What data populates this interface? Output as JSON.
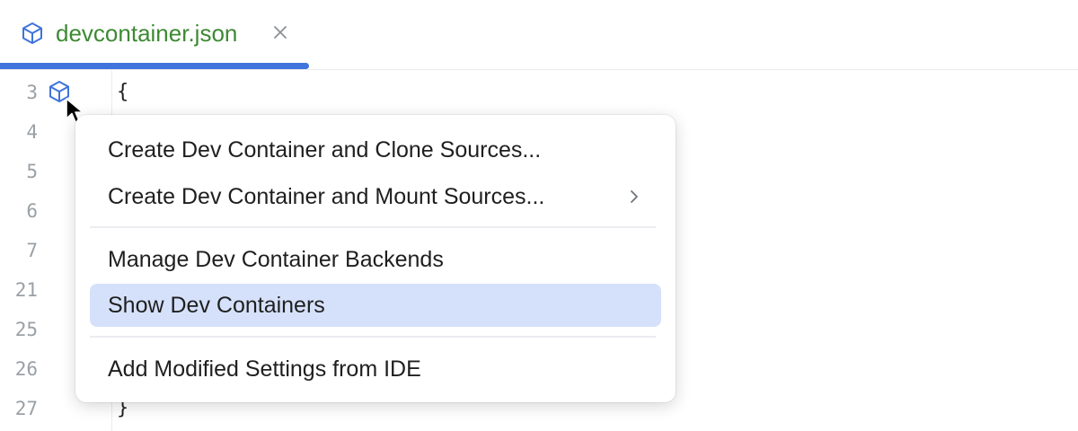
{
  "tab": {
    "title": "devcontainer.json",
    "icon": "cube-icon",
    "close_icon": "close-icon",
    "title_color": "#3d8a33",
    "underline_color": "#3e74dc"
  },
  "editor": {
    "line_numbers": [
      "3",
      "4",
      "5",
      "6",
      "7",
      "21",
      "25",
      "26",
      "27"
    ],
    "code_lines": {
      "first": "{",
      "last": "}"
    },
    "gutter_icon": "cube-icon"
  },
  "menu": {
    "items": [
      {
        "label": "Create Dev Container and Clone Sources...",
        "has_submenu": false
      },
      {
        "label": "Create Dev Container and Mount Sources...",
        "has_submenu": true
      },
      {
        "label": "Manage Dev Container Backends",
        "has_submenu": false
      },
      {
        "label": "Show Dev Containers",
        "has_submenu": false,
        "selected": true
      },
      {
        "label": "Add Modified Settings from IDE",
        "has_submenu": false
      }
    ],
    "selected_color": "#d5e1fb"
  }
}
